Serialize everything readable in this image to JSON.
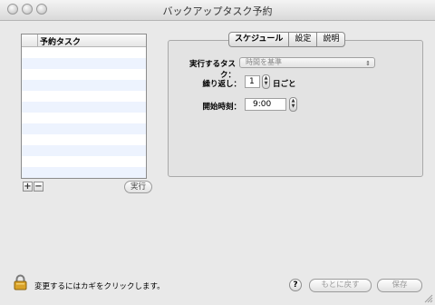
{
  "window": {
    "title": "バックアップタスク予約"
  },
  "tasklist": {
    "header": "予約タスク",
    "rows": 12
  },
  "buttons": {
    "add": "+",
    "remove": "−",
    "run": "実行",
    "help": "?",
    "revert": "もとに戻す",
    "save": "保存"
  },
  "tabs": [
    {
      "label": "スケジュール",
      "active": true
    },
    {
      "label": "設定",
      "active": false
    },
    {
      "label": "説明",
      "active": false
    }
  ],
  "schedule": {
    "task_label": "実行するタスク：",
    "task_value": "時間を基準",
    "repeat_label": "繰り返し：",
    "repeat_value": "1",
    "repeat_suffix": "日ごと",
    "start_label": "開始時刻：",
    "start_value": "9:00"
  },
  "status": {
    "text": "変更するにはカギをクリックします。"
  },
  "colors": {
    "window_bg": "#e9e9e9",
    "row_stripe": "#edf3fe",
    "panel_bg": "#e3e3e3"
  },
  "icons": {
    "lock": "lock-icon",
    "help": "help-icon"
  }
}
